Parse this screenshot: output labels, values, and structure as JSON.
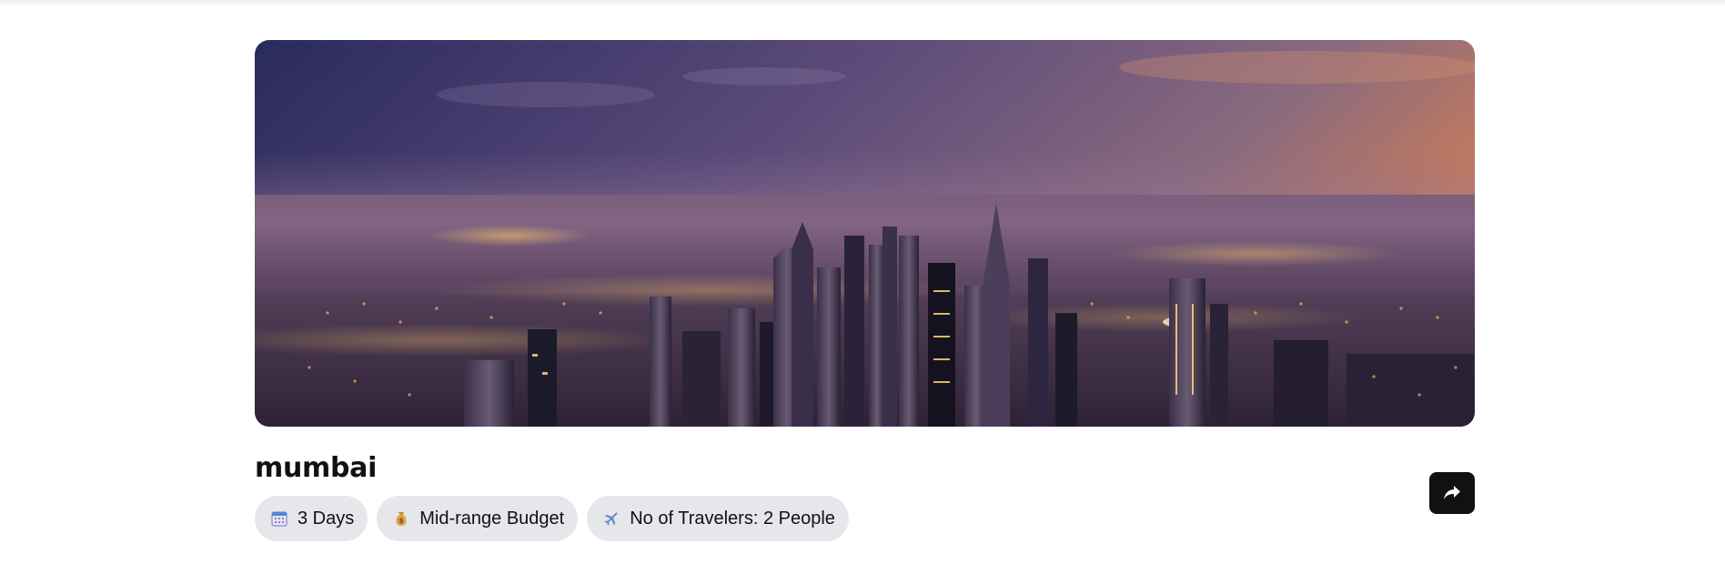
{
  "hero": {
    "alt": "City skyline at dusk"
  },
  "trip": {
    "title": "mumbai",
    "badges": [
      {
        "icon": "calendar-icon",
        "label": "3 Days"
      },
      {
        "icon": "money-bag-icon",
        "label": "Mid-range Budget"
      },
      {
        "icon": "airplane-icon",
        "label": "No of Travelers: 2 People"
      }
    ]
  },
  "actions": {
    "share_icon": "share-arrow-icon"
  },
  "colors": {
    "badge_bg": "#e5e7eb",
    "share_bg": "#111111"
  }
}
